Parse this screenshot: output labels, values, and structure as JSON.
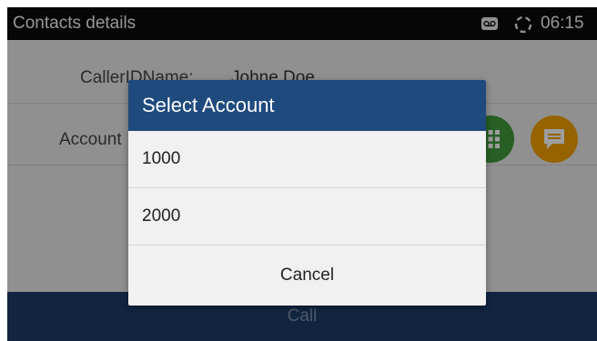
{
  "status_bar": {
    "title": "Contacts details",
    "time": "06:15",
    "icons": [
      "voicemail-icon",
      "sync-icon"
    ]
  },
  "details": {
    "caller_id_label": "CallerIDName:",
    "caller_id_value": "Johne Doe",
    "account_label": "Account"
  },
  "actions": {
    "call_label": "Call",
    "icons": [
      "dialpad-icon",
      "message-icon"
    ]
  },
  "dialog": {
    "title": "Select Account",
    "options": [
      "1000",
      "2000"
    ],
    "cancel_label": "Cancel"
  },
  "colors": {
    "dialog_header": "#1f4a7e",
    "call_bar": "#1c3c68",
    "dialpad_button": "#3f9a3a",
    "message_button": "#f0a000"
  }
}
